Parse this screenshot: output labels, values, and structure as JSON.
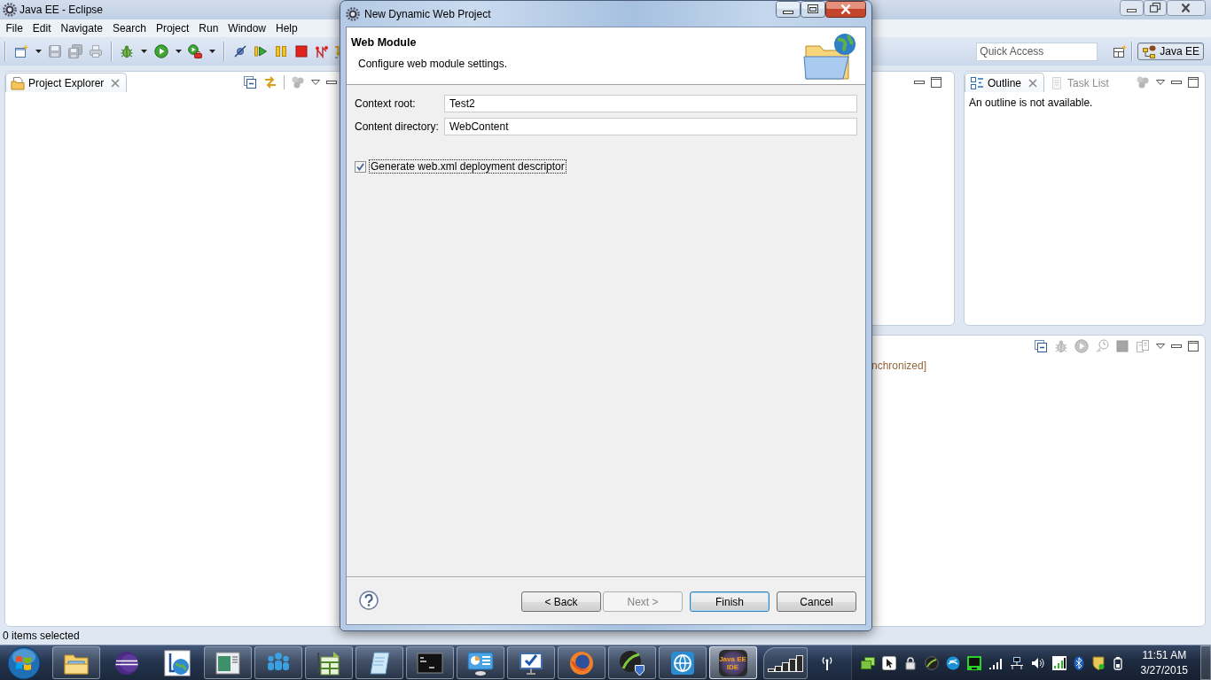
{
  "window": {
    "title": "Java EE - Eclipse"
  },
  "menu": [
    {
      "label": "File"
    },
    {
      "label": "Edit"
    },
    {
      "label": "Navigate"
    },
    {
      "label": "Search"
    },
    {
      "label": "Project"
    },
    {
      "label": "Run"
    },
    {
      "label": "Window"
    },
    {
      "label": "Help"
    }
  ],
  "toolbar": {
    "groups": [
      [
        {
          "kind": "new",
          "disabled": false
        },
        {
          "kind": "save",
          "disabled": true
        },
        {
          "kind": "saveall",
          "disabled": true
        },
        {
          "kind": "print",
          "disabled": true
        }
      ],
      [
        {
          "kind": "debug",
          "disabled": false
        },
        {
          "kind": "run",
          "disabled": false
        },
        {
          "kind": "external",
          "disabled": false
        }
      ],
      [
        {
          "kind": "skip",
          "disabled": false
        },
        {
          "kind": "resume",
          "disabled": false
        },
        {
          "kind": "suspend",
          "disabled": false
        },
        {
          "kind": "terminate",
          "disabled": false
        },
        {
          "kind": "disconnect",
          "disabled": false
        },
        {
          "kind": "stepinto",
          "disabled": false
        }
      ]
    ]
  },
  "quick_access": {
    "placeholder": "Quick Access"
  },
  "perspectives": [
    {
      "label": "Java EE",
      "selected": true
    }
  ],
  "project_explorer": {
    "tabs": [
      {
        "kind": "explorer",
        "label": "Project Explorer",
        "selected": true
      }
    ],
    "tools": [
      [
        {
          "kind": "collapse",
          "disabled": false
        },
        {
          "kind": "link",
          "disabled": false
        }
      ],
      [
        {
          "kind": "focus",
          "disabled": true
        }
      ]
    ]
  },
  "outline_view": {
    "tabs": [
      {
        "kind": "outline",
        "label": "Outline",
        "selected": true
      },
      {
        "kind": "tasks",
        "label": "Task List",
        "selected": false
      }
    ],
    "tools": [
      [
        {
          "kind": "focus",
          "disabled": true
        }
      ]
    ],
    "message": "An outline is not available."
  },
  "lower_view": {
    "tools": [
      [
        {
          "kind": "collapse",
          "disabled": false
        },
        {
          "kind": "debug",
          "disabled": true
        },
        {
          "kind": "run",
          "disabled": true
        },
        {
          "kind": "publish",
          "disabled": true
        },
        {
          "kind": "stop",
          "disabled": true
        },
        {
          "kind": "pages",
          "disabled": true
        }
      ]
    ],
    "text": "nchronized]"
  },
  "status_bar": {
    "text": "0 items selected"
  },
  "dialog": {
    "title": "New Dynamic Web Project",
    "header": {
      "title": "Web Module",
      "description": "Configure web module settings."
    },
    "fields": [
      {
        "label": "Context root:",
        "value": "Test2"
      },
      {
        "label": "Content directory:",
        "value": "WebContent"
      }
    ],
    "checkbox": {
      "label": "Generate web.xml deployment descriptor",
      "checked": true,
      "focused": true
    },
    "buttons": [
      {
        "label": "< Back",
        "disabled": false,
        "default": false
      },
      {
        "label": "Next >",
        "disabled": true,
        "default": false
      },
      {
        "label": "Finish",
        "disabled": false,
        "default": true
      },
      {
        "label": "Cancel",
        "disabled": false,
        "default": false
      }
    ]
  },
  "taskbar": {
    "apps": [
      {
        "kind": "explorer",
        "running": true,
        "selected": false
      },
      {
        "kind": "sphere",
        "running": false,
        "selected": false
      },
      {
        "kind": "globestand",
        "running": false,
        "selected": false
      },
      {
        "kind": "window",
        "running": true,
        "selected": false
      },
      {
        "kind": "people",
        "running": true,
        "selected": false
      },
      {
        "kind": "spreadsheet",
        "running": true,
        "selected": false
      },
      {
        "kind": "notepad",
        "running": true,
        "selected": false
      },
      {
        "kind": "terminal",
        "running": true,
        "selected": false
      },
      {
        "kind": "dashboard",
        "running": true,
        "selected": false
      },
      {
        "kind": "monitor",
        "running": true,
        "selected": false
      },
      {
        "kind": "browser",
        "running": true,
        "selected": false
      },
      {
        "kind": "swooshshield",
        "running": true,
        "selected": false
      },
      {
        "kind": "globe",
        "running": true,
        "selected": false
      },
      {
        "kind": "ide",
        "running": true,
        "selected": true,
        "label": "Java EE IDE"
      }
    ],
    "tray": [
      {
        "kind": "stack"
      },
      {
        "kind": "cursor"
      },
      {
        "kind": "lock"
      },
      {
        "kind": "swoosh"
      },
      {
        "kind": "swirl"
      },
      {
        "kind": "screen"
      },
      {
        "kind": "signal"
      },
      {
        "kind": "network"
      },
      {
        "kind": "speaker"
      },
      {
        "kind": "bars"
      },
      {
        "kind": "bluetooth"
      },
      {
        "kind": "shield"
      },
      {
        "kind": "battery"
      }
    ],
    "clock": {
      "time": "11:51 AM",
      "date": "3/27/2015"
    }
  }
}
